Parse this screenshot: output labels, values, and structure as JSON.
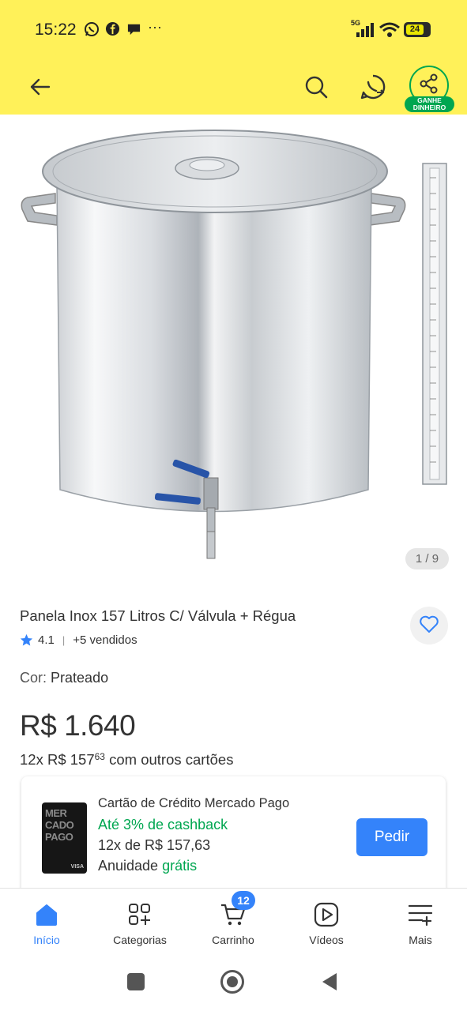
{
  "status_bar": {
    "time": "15:22",
    "network": "5G",
    "battery": "24"
  },
  "header": {
    "back_icon": "arrow-left-icon",
    "search_icon": "search-icon",
    "whatsapp_icon": "whatsapp-share-icon",
    "share_icon": "share-icon",
    "ganhe_line1": "GANHE",
    "ganhe_line2": "DINHEIRO",
    "accent_color": "#fff159"
  },
  "gallery": {
    "counter": "1 / 9",
    "image": "stainless-steel-pot-with-valve-and-ruler"
  },
  "product": {
    "title": "Panela Inox 157 Litros C/ Válvula + Régua",
    "rating": "4.1",
    "sold": "+5 vendidos",
    "color_label": "Cor:",
    "color_value": "Prateado",
    "price": "R$ 1.640",
    "installments_prefix": "12x R$ 157",
    "installments_cents": "63",
    "installments_suffix": " com outros cartões"
  },
  "credit_card": {
    "title": "Cartão de Crédito Mercado Pago",
    "cashback": "Até 3% de cashback",
    "installments": "12x de R$ 157,63",
    "annuity_label": "Anuidade ",
    "annuity_value": "grátis",
    "button": "Pedir",
    "card_text": "MERCADO PAGO",
    "card_brand": "VISA",
    "button_color": "#3483fa",
    "green_color": "#00a650"
  },
  "bottom_nav": {
    "items": [
      {
        "label": "Início",
        "icon": "home-icon",
        "active": true
      },
      {
        "label": "Categorias",
        "icon": "categories-icon"
      },
      {
        "label": "Carrinho",
        "icon": "cart-icon",
        "badge": "12"
      },
      {
        "label": "Vídeos",
        "icon": "play-video-icon"
      },
      {
        "label": "Mais",
        "icon": "menu-plus-icon"
      }
    ]
  },
  "system_nav": {
    "recents": "square-icon",
    "home": "circle-icon",
    "back": "triangle-back-icon"
  }
}
